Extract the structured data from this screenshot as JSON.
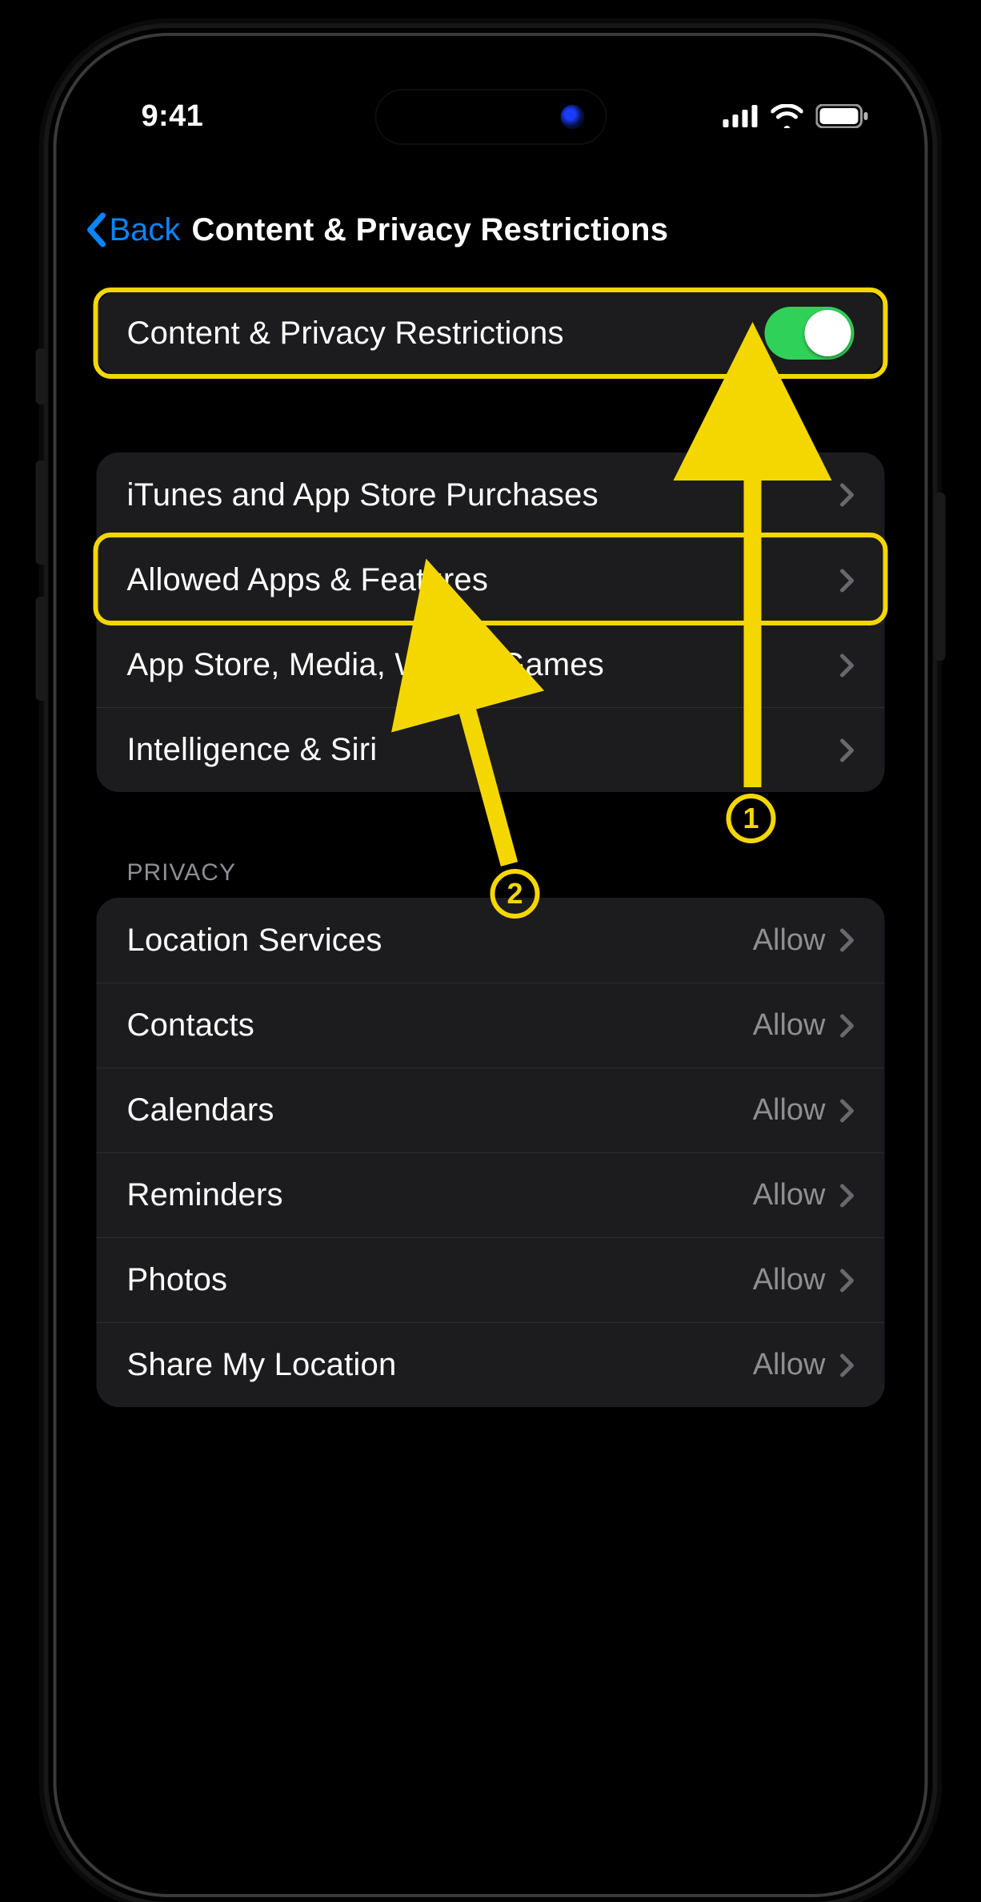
{
  "status": {
    "time": "9:41"
  },
  "nav": {
    "back_label": "Back",
    "title": "Content & Privacy Restrictions"
  },
  "toggle_row": {
    "label": "Content & Privacy Restrictions",
    "on": true
  },
  "group1": {
    "items": [
      {
        "label": "iTunes and App Store Purchases"
      },
      {
        "label": "Allowed Apps & Features"
      },
      {
        "label": "App Store, Media, Web & Games"
      },
      {
        "label": "Intelligence & Siri"
      }
    ]
  },
  "privacy": {
    "header": "PRIVACY",
    "items": [
      {
        "label": "Location Services",
        "value": "Allow"
      },
      {
        "label": "Contacts",
        "value": "Allow"
      },
      {
        "label": "Calendars",
        "value": "Allow"
      },
      {
        "label": "Reminders",
        "value": "Allow"
      },
      {
        "label": "Photos",
        "value": "Allow"
      },
      {
        "label": "Share My Location",
        "value": "Allow"
      }
    ]
  },
  "annotations": {
    "badge1": "1",
    "badge2": "2"
  },
  "colors": {
    "accent_link": "#0a84ff",
    "toggle_on": "#30d158",
    "highlight": "#f5d700",
    "cell_bg": "#1c1c1e",
    "separator": "#2c2c2e",
    "secondary": "#8e8e93"
  }
}
